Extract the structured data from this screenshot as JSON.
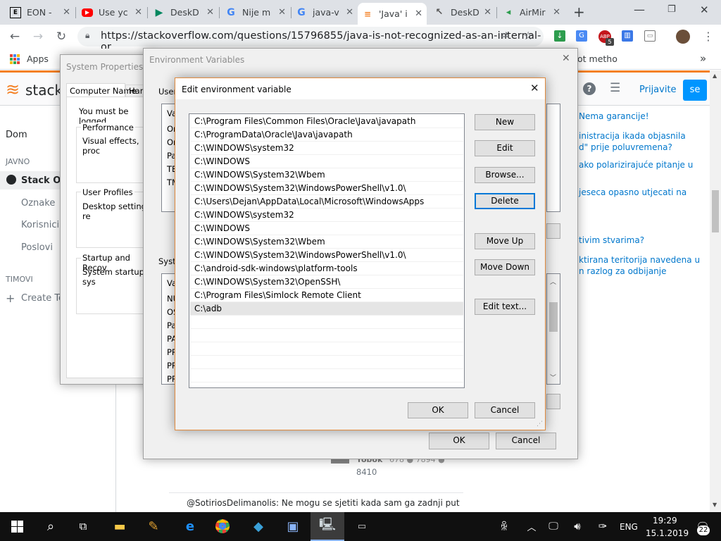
{
  "browser": {
    "tabs": [
      {
        "title": "EON -",
        "icon": "eon-icon"
      },
      {
        "title": "Use yc",
        "icon": "youtube-icon"
      },
      {
        "title": "DeskD",
        "icon": "play-store-icon"
      },
      {
        "title": "Nije m",
        "icon": "google-icon"
      },
      {
        "title": "java-v",
        "icon": "google-icon"
      },
      {
        "title": "'Java' i",
        "icon": "stackoverflow-icon"
      },
      {
        "title": "DeskD",
        "icon": "deskdock-icon"
      },
      {
        "title": "AirMir",
        "icon": "airmirror-icon"
      }
    ],
    "new_tab": "+",
    "url": "https://stackoverflow.com/questions/15796855/java-is-not-recognized-as-an-internal-or...",
    "apps_label": "Apps",
    "bookmark_partial": "ot metho",
    "bookmark_overflow": "»",
    "ext_badge": "5"
  },
  "so": {
    "logo_text": "stack o",
    "login_label": "Prijavite",
    "signup_label": "se",
    "left_nav": {
      "home": "Dom",
      "public_header": "JAVNO",
      "stack_overflow": "Stack Ov",
      "tags": "Oznake",
      "users": "Korisnici",
      "jobs": "Poslovi",
      "teams_header": "TIMOVI",
      "create_team": "Create Te"
    },
    "sidebar_links": [
      "Nema garancije!",
      "inistracija ikada objasnila\nd\" prije poluvremena?",
      "ako polarizirajuće pitanje u",
      "jeseca opasno utjecati na",
      "tivim stvarima?",
      "ktirana teritorija navedena u\nn razlog za odbijanje"
    ],
    "user_card_name": "Yobok",
    "user_card_stats": "678 ● 7894 ●",
    "user_card_rep": "8410",
    "comment": "@SotiriosDelimanolis: Ne mogu se sjetiti kada sam ga zadnji put"
  },
  "system_properties": {
    "title": "System Properties",
    "tabs": [
      "Computer Name",
      "Har"
    ],
    "admin_note": "You must be logged",
    "performance_label": "Performance",
    "performance_text": "Visual effects, proc",
    "profiles_label": "User Profiles",
    "profiles_text": "Desktop settings re",
    "startup_label": "Startup and Recov",
    "startup_text": "System startup, sys"
  },
  "env_vars": {
    "title": "Environment Variables",
    "user_label": "User",
    "user_col": "Va",
    "user_rows": [
      "Or",
      "Or",
      "Pa",
      "TE",
      "TM"
    ],
    "system_label": "Syste",
    "system_col": "Va",
    "system_rows": [
      "NU",
      "OS",
      "Pa",
      "PA",
      "PR",
      "PR",
      "PR"
    ],
    "ok": "OK",
    "cancel": "Cancel"
  },
  "edit_dialog": {
    "title": "Edit environment variable",
    "close": "✕",
    "paths": [
      "C:\\Program Files\\Common Files\\Oracle\\Java\\javapath",
      "C:\\ProgramData\\Oracle\\Java\\javapath",
      "C:\\WINDOWS\\system32",
      "C:\\WINDOWS",
      "C:\\WINDOWS\\System32\\Wbem",
      "C:\\WINDOWS\\System32\\WindowsPowerShell\\v1.0\\",
      "C:\\Users\\Dejan\\AppData\\Local\\Microsoft\\WindowsApps",
      "C:\\WINDOWS\\system32",
      "C:\\WINDOWS",
      "C:\\WINDOWS\\System32\\Wbem",
      "C:\\WINDOWS\\System32\\WindowsPowerShell\\v1.0\\",
      "C:\\android-sdk-windows\\platform-tools",
      "C:\\WINDOWS\\System32\\OpenSSH\\",
      "C:\\Program Files\\Simlock Remote Client",
      "C:\\adb"
    ],
    "buttons": {
      "new": "New",
      "edit": "Edit",
      "browse": "Browse...",
      "delete": "Delete",
      "move_up": "Move Up",
      "move_down": "Move Down",
      "edit_text": "Edit text...",
      "ok": "OK",
      "cancel": "Cancel"
    }
  },
  "taskbar": {
    "language": "ENG",
    "time": "19:29",
    "date": "15.1.2019",
    "notifications": "22"
  },
  "colors": {
    "so_orange": "#f48024",
    "so_blue": "#0095ff",
    "dialog_accent": "#0078d7",
    "taskbar": "#101010"
  }
}
